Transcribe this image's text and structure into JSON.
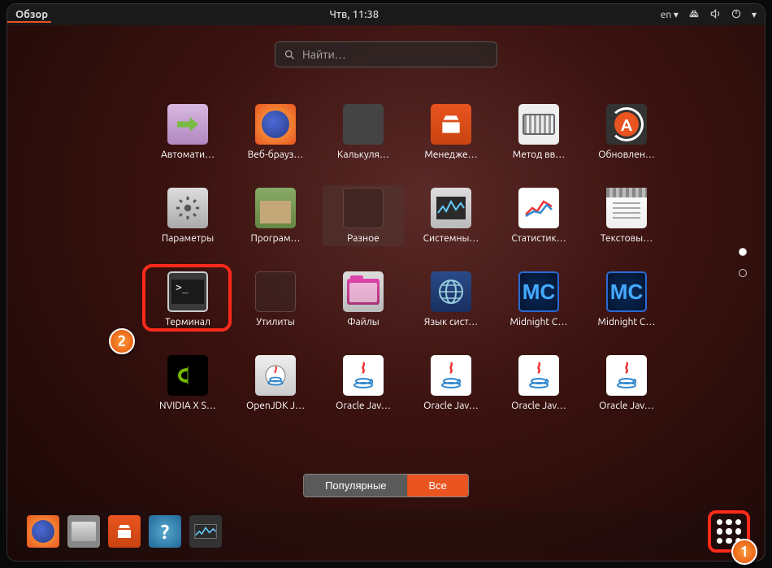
{
  "topbar": {
    "activities": "Обзор",
    "clock": "Чтв, 11:38",
    "lang": "en ▾"
  },
  "search": {
    "placeholder": "Найти…"
  },
  "apps": [
    {
      "label": "Автомати…",
      "name": "app-auto-login",
      "icon": "login"
    },
    {
      "label": "Веб-брауз…",
      "name": "app-firefox",
      "icon": "firefox"
    },
    {
      "label": "Калькуля…",
      "name": "app-calculator",
      "icon": "calc"
    },
    {
      "label": "Менедже…",
      "name": "app-software",
      "icon": "software"
    },
    {
      "label": "Метод вв…",
      "name": "app-input-method",
      "icon": "keyboard"
    },
    {
      "label": "Обновлен…",
      "name": "app-updater",
      "icon": "update"
    },
    {
      "label": "Параметры",
      "name": "app-settings",
      "icon": "settings"
    },
    {
      "label": "Програм…",
      "name": "app-packages",
      "icon": "pkg"
    },
    {
      "label": "Разное",
      "name": "folder-misc",
      "icon": "misc",
      "hl": true
    },
    {
      "label": "Системны…",
      "name": "app-system-monitor",
      "icon": "sysmon"
    },
    {
      "label": "Статистик…",
      "name": "app-stats",
      "icon": "stats"
    },
    {
      "label": "Текстовы…",
      "name": "app-text-editor",
      "icon": "text"
    },
    {
      "label": "Терминал",
      "name": "app-terminal",
      "icon": "term",
      "ring": true
    },
    {
      "label": "Утилиты",
      "name": "folder-utilities",
      "icon": "utils"
    },
    {
      "label": "Файлы",
      "name": "app-files",
      "icon": "files"
    },
    {
      "label": "Язык сист…",
      "name": "app-language",
      "icon": "lang"
    },
    {
      "label": "Midnight C…",
      "name": "app-mc-1",
      "icon": "mc"
    },
    {
      "label": "Midnight C…",
      "name": "app-mc-2",
      "icon": "mc"
    },
    {
      "label": "NVIDIA X S…",
      "name": "app-nvidia",
      "icon": "nvidia"
    },
    {
      "label": "OpenJDK J…",
      "name": "app-openjdk",
      "icon": "openjdk"
    },
    {
      "label": "Oracle Jav…",
      "name": "app-oracle-1",
      "icon": "java"
    },
    {
      "label": "Oracle Jav…",
      "name": "app-oracle-2",
      "icon": "java"
    },
    {
      "label": "Oracle Jav…",
      "name": "app-oracle-3",
      "icon": "java"
    },
    {
      "label": "Oracle Jav…",
      "name": "app-oracle-4",
      "icon": "java"
    }
  ],
  "segmented": {
    "frequent": "Популярные",
    "all": "Все"
  },
  "badges": {
    "b1": "1",
    "b2": "2"
  }
}
